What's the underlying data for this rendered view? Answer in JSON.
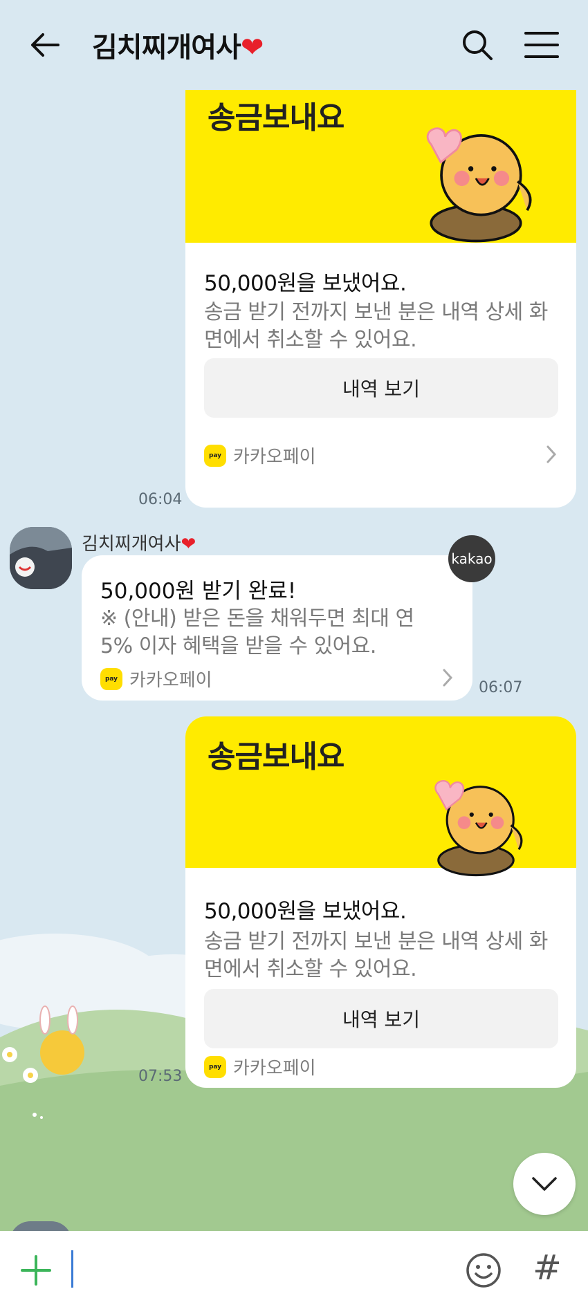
{
  "header": {
    "title": "김치찌개여사",
    "title_heart": "❤"
  },
  "messages": [
    {
      "type": "sent_transfer",
      "banner_title": "송금보내요",
      "amount_text": "50,000원을 보냈어요.",
      "description": "송금 받기 전까지 보낸 분은 내역 상세 화면에서 취소할 수 있어요.",
      "button_label": "내역 보기",
      "pay_label": "카카오페이",
      "time": "06:04"
    },
    {
      "type": "received_notice",
      "sender": "김치찌개여사",
      "sender_heart": "❤",
      "badge": "kakao",
      "title": "50,000원 받기 완료!",
      "description": "※ (안내) 받은 돈을 채워두면 최대 연 5% 이자 혜택을 받을 수 있어요.",
      "pay_label": "카카오페이",
      "time": "06:07"
    },
    {
      "type": "sent_transfer",
      "banner_title": "송금보내요",
      "amount_text": "50,000원을 보냈어요.",
      "description": "송금 받기 전까지 보낸 분은 내역 상세 화면에서 취소할 수 있어요.",
      "button_label": "내역 보기",
      "pay_label": "카카오페이",
      "time": "07:53"
    }
  ],
  "icons": {
    "back": "arrow-left-icon",
    "search": "search-icon",
    "menu": "hamburger-menu-icon",
    "scroll_down": "chevron-down-icon",
    "plus": "plus-icon",
    "emoji": "emoji-icon",
    "hashtag": "hashtag-icon"
  },
  "input_bar": {
    "hash_symbol": "#"
  },
  "colors": {
    "background": "#d9e8f1",
    "kakao_yellow": "#ffeb00",
    "plus_green": "#3cb55a"
  }
}
